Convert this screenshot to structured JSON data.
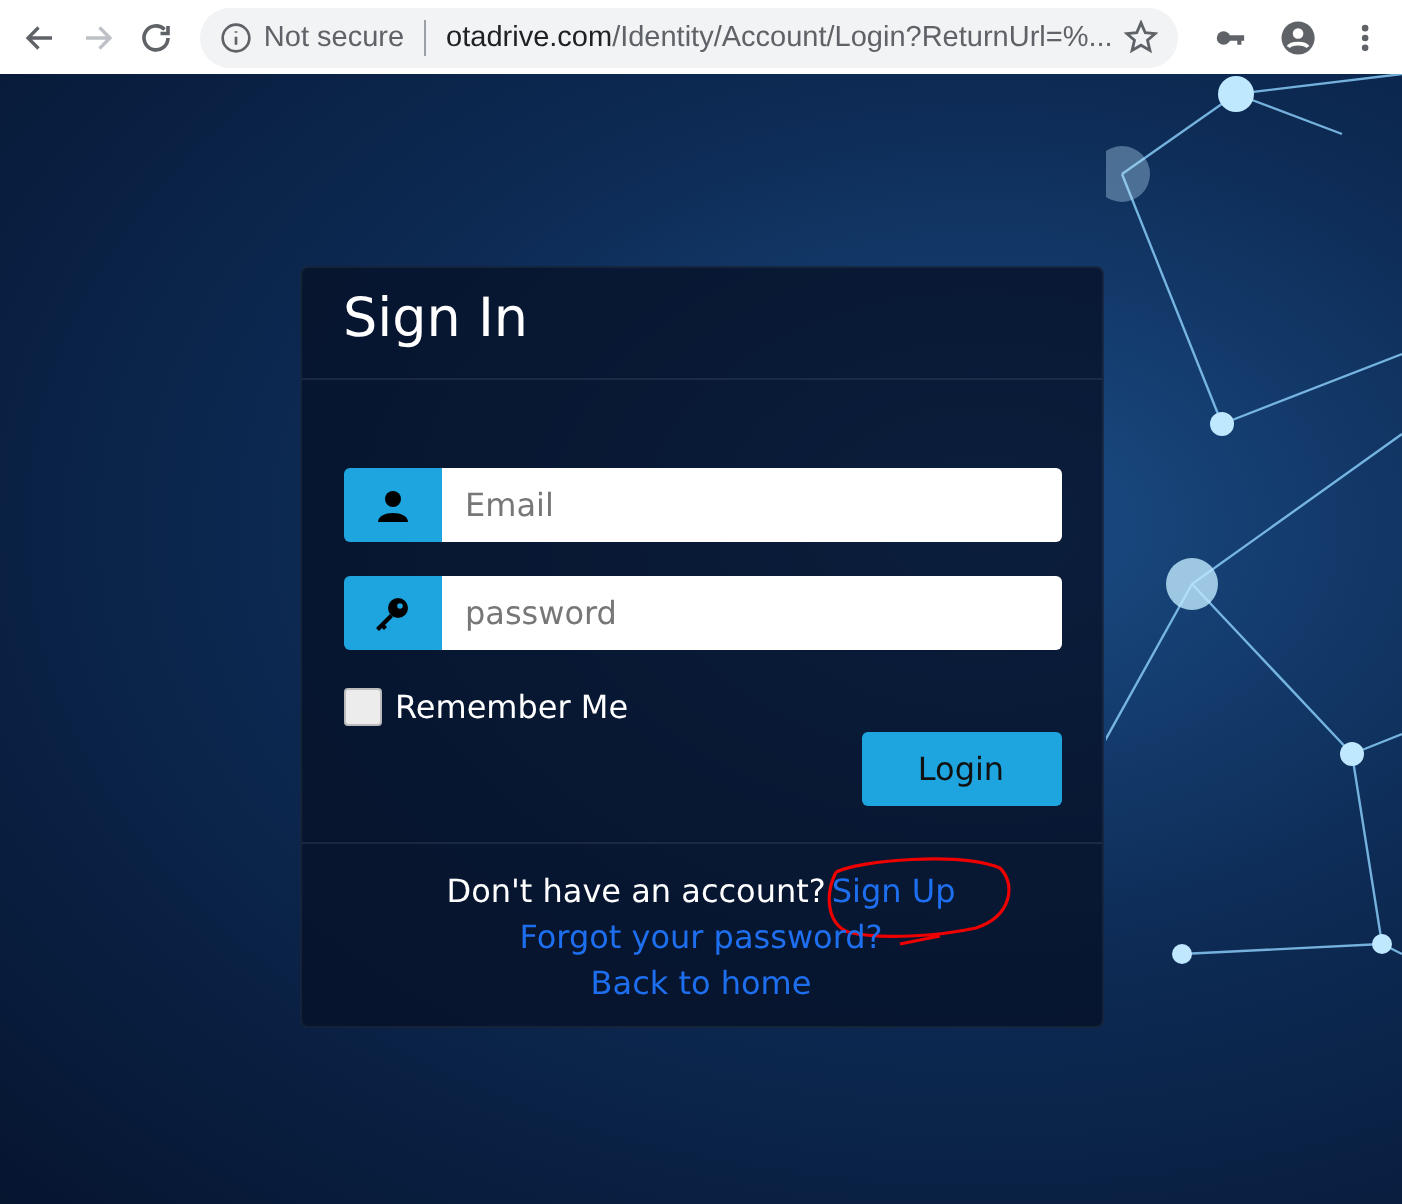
{
  "browser": {
    "back_enabled": true,
    "forward_enabled": false,
    "security_label": "Not secure",
    "url_host": "otadrive.com",
    "url_path": "/Identity/Account/Login?ReturnUrl=%..."
  },
  "login_card": {
    "title": "Sign In",
    "email": {
      "placeholder": "Email"
    },
    "password": {
      "placeholder": "password"
    },
    "remember_me": {
      "label": "Remember Me",
      "checked": false
    },
    "login_button": "Login",
    "signup_prompt": "Don't have an account?",
    "signup_link": "Sign Up",
    "forgot_link": "Forgot your password?",
    "home_link": "Back to home"
  }
}
